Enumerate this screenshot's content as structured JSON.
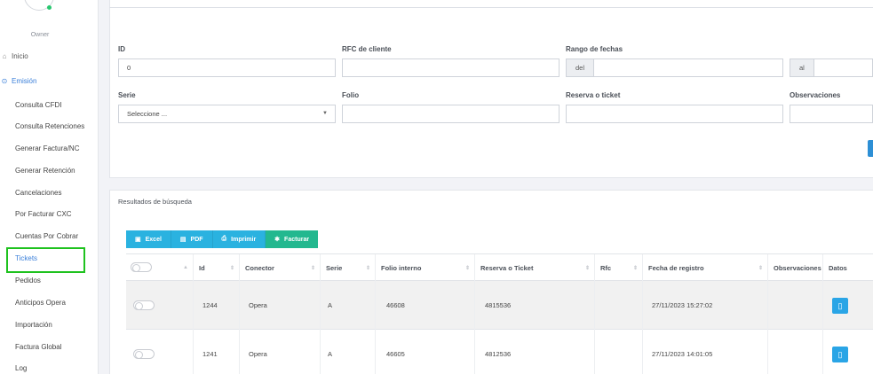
{
  "sidebar": {
    "role": "Owner",
    "home_label": "Inicio",
    "section_label": "Emisión",
    "items": [
      "Consulta CFDI",
      "Consulta Retenciones",
      "Generar Factura/NC",
      "Generar Retención",
      "Cancelaciones",
      "Por Facturar CXC",
      "Cuentas Por Cobrar",
      "Tickets",
      "Pedidos",
      "Anticipos Opera",
      "Importación",
      "Factura Global",
      "Log"
    ],
    "selected_item": "Tickets"
  },
  "filters": {
    "id_label": "ID",
    "id_value": "0",
    "rfc_label": "RFC de cliente",
    "rfc_value": "",
    "date_range_label": "Rango de fechas",
    "date_from_addon": "del",
    "date_to_addon": "al",
    "serie_label": "Serie",
    "serie_value": "Seleccione ...",
    "folio_label": "Folio",
    "reserva_label": "Reserva o ticket",
    "observaciones_label": "Observaciones"
  },
  "results": {
    "title": "Resultados de búsqueda",
    "buttons": {
      "excel": "Excel",
      "pdf": "PDF",
      "print": "Imprimir",
      "invoice": "Facturar"
    },
    "columns": {
      "id": "Id",
      "conector": "Conector",
      "serie": "Serie",
      "folio": "Folio interno",
      "reserva": "Reserva o Ticket",
      "rfc": "Rfc",
      "fecha": "Fecha de registro",
      "observaciones": "Observaciones",
      "datos": "Datos"
    },
    "rows": [
      {
        "id": "1244",
        "conector": "Opera",
        "serie": "A",
        "folio": "46608",
        "reserva": "4815536",
        "rfc": "",
        "fecha": "27/11/2023 15:27:02",
        "observaciones": ""
      },
      {
        "id": "1241",
        "conector": "Opera",
        "serie": "A",
        "folio": "46605",
        "reserva": "4812536",
        "rfc": "",
        "fecha": "27/11/2023 14:01:05",
        "observaciones": ""
      }
    ]
  },
  "colors": {
    "accent": "#3a7fd9",
    "button_blue": "#2ab2e0",
    "button_green": "#23b88f",
    "highlight_box": "#1ec21e",
    "status_dot": "#28c76f"
  }
}
